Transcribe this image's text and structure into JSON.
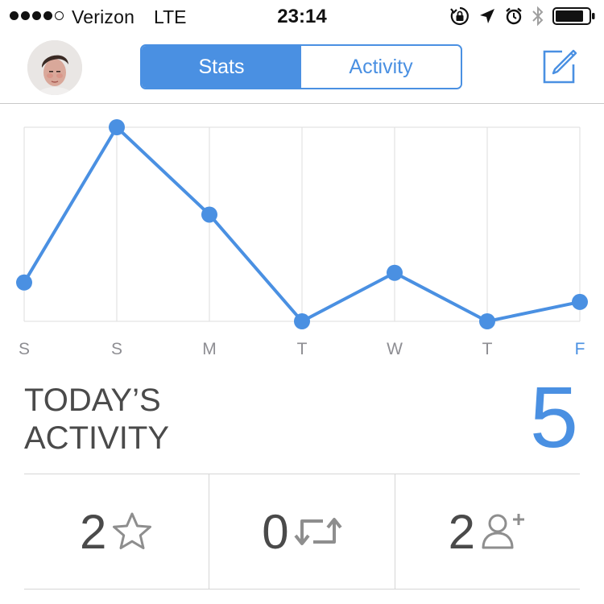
{
  "status_bar": {
    "carrier": "Verizon",
    "network": "LTE",
    "time": "23:14",
    "signal_bars_filled": 4,
    "signal_bars_total": 5,
    "icons": [
      "orientation-lock-icon",
      "location-arrow-icon",
      "alarm-icon",
      "bluetooth-icon",
      "battery-icon"
    ],
    "battery_level": 0.85
  },
  "nav": {
    "avatar_icon": "profile-avatar",
    "tabs": [
      {
        "label": "Stats",
        "active": true
      },
      {
        "label": "Activity",
        "active": false
      }
    ],
    "compose_icon": "compose-icon"
  },
  "chart_data": {
    "type": "line",
    "categories": [
      "S",
      "S",
      "M",
      "T",
      "W",
      "T",
      "F"
    ],
    "values": [
      2,
      10,
      5.5,
      0,
      2.5,
      0,
      1
    ],
    "ylim": [
      0,
      10
    ],
    "highlight_category_index": 6,
    "grid": true,
    "line_color": "#4a90e2",
    "label_color": "#8e8e93",
    "highlight_color": "#4a90e2"
  },
  "today": {
    "label_line1": "TODAY’S",
    "label_line2": "ACTIVITY",
    "count": "5"
  },
  "stats": [
    {
      "value": "2",
      "icon": "star-outline-icon"
    },
    {
      "value": "0",
      "icon": "retweet-icon"
    },
    {
      "value": "2",
      "icon": "follower-add-icon"
    }
  ],
  "colors": {
    "accent": "#4a90e2",
    "text": "#4a4a4a",
    "divider": "#d6d6d6"
  }
}
